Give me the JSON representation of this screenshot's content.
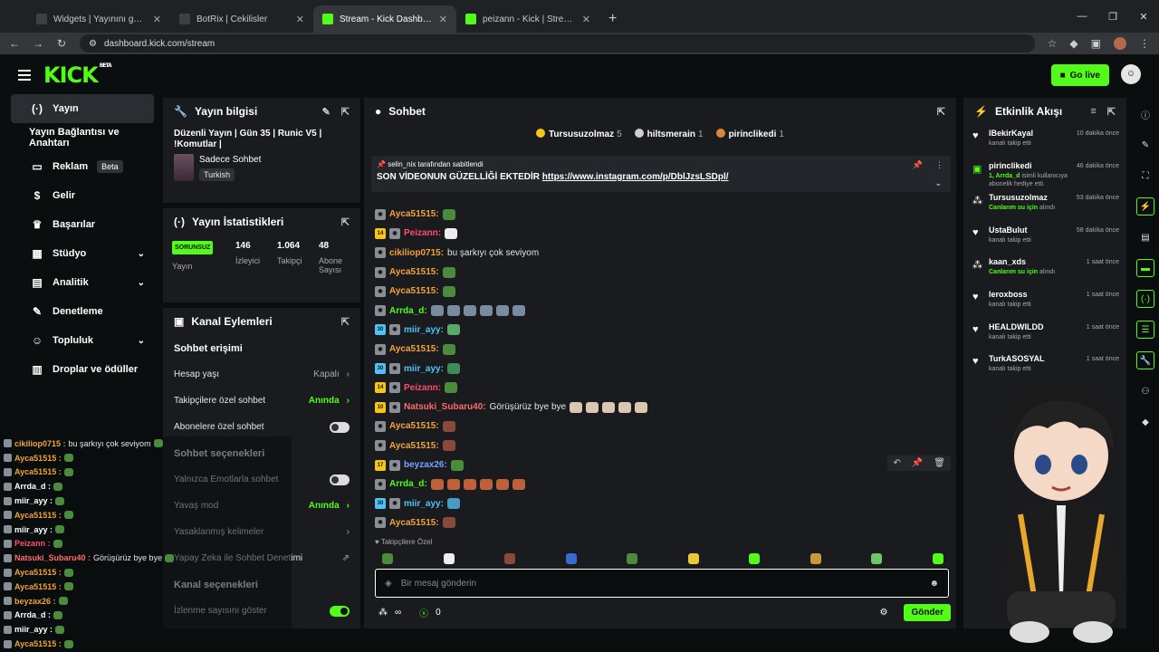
{
  "browser": {
    "tabs": [
      {
        "label": "Widgets | Yayınını güçlendirme",
        "color": "#3c4043",
        "active": false
      },
      {
        "label": "BotRix | Cekilisler",
        "color": "#3c4043",
        "active": false
      },
      {
        "label": "Stream - Kick Dashboard",
        "color": "#53fc18",
        "active": true
      },
      {
        "label": "peizann - Kick | StreamerStats",
        "color": "#53fc18",
        "active": false
      }
    ],
    "url": "dashboard.kick.com/stream"
  },
  "header": {
    "logo": "KICK",
    "beta": "BETA",
    "go_live": "Go live"
  },
  "sidebar": {
    "items": [
      {
        "icon": "(·)",
        "label": "Yayın",
        "active": true
      },
      {
        "icon": "",
        "label": "Yayın Bağlantısı ve Anahtarı",
        "sub": true
      },
      {
        "icon": "▭",
        "label": "Reklam",
        "badge": "Beta"
      },
      {
        "icon": "$",
        "label": "Gelir"
      },
      {
        "icon": "♛",
        "label": "Başarılar"
      },
      {
        "icon": "▦",
        "label": "Stüdyo",
        "chev": true
      },
      {
        "icon": "▤",
        "label": "Analitik",
        "chev": true
      },
      {
        "icon": "✎",
        "label": "Denetleme"
      },
      {
        "icon": "☺",
        "label": "Topluluk",
        "chev": true
      },
      {
        "icon": "▥",
        "label": "Droplar ve ödüller"
      }
    ]
  },
  "stream_info": {
    "title": "Yayın bilgisi",
    "stream_title": "Düzenli Yayın | Gün 35 | Runic V5 | !Komutlar |",
    "category": "Sadece Sohbet",
    "language": "Turkish"
  },
  "stream_stats": {
    "title": "Yayın İstatistikleri",
    "status": "SORUNSUZ",
    "status_label": "Yayın",
    "stats": [
      {
        "value": "146",
        "label": "İzleyici"
      },
      {
        "value": "1.064",
        "label": "Takipçi"
      },
      {
        "value": "48",
        "label": "Abone Sayısı"
      }
    ]
  },
  "channel_actions": {
    "title": "Kanal Eylemleri",
    "section1": "Sohbet erişimi",
    "rows1": [
      {
        "label": "Hesap yaşı",
        "value": "Kapalı",
        "kind": "chev"
      },
      {
        "label": "Takipçilere özel sohbet",
        "value": "Anında",
        "kind": "green"
      },
      {
        "label": "Abonelere özel sohbet",
        "value": "",
        "kind": "toggle"
      }
    ],
    "section2": "Sohbet seçenekleri",
    "rows2": [
      {
        "label": "Yalnızca Emotlarla sohbet",
        "value": "",
        "kind": "toggle"
      },
      {
        "label": "Yavaş mod",
        "value": "Anında",
        "kind": "green"
      },
      {
        "label": "Yasaklanmış kelimeler",
        "value": "",
        "kind": "chev"
      },
      {
        "label": "Yapay Zeka ile Sohbet Denetimi",
        "value": "",
        "kind": "ext"
      }
    ],
    "section3": "Kanal seçenekleri",
    "rows3": [
      {
        "label": "İzlenme sayısını göster",
        "value": "",
        "kind": "toggle-on"
      }
    ]
  },
  "chat": {
    "title": "Sohbet",
    "top_gifters": [
      {
        "name": "Tursusuzolmaz",
        "count": "5",
        "color": "#f5c518"
      },
      {
        "name": "hiltsmerain",
        "count": "1",
        "color": "#cfcfcf"
      },
      {
        "name": "pirinclikedi",
        "count": "1",
        "color": "#d9893b"
      }
    ],
    "pinned_by": "selin_nix tarafından sabitlendi",
    "pinned_text": "SON VİDEONUN GÜZELLİĞİ EKTEDİR",
    "pinned_link": "https://www.instagram.com/p/DblJzsLSDpl/",
    "messages": [
      {
        "user": "Ayca51515:",
        "color": "#f2a33a",
        "text": "",
        "sub": "",
        "emotes": [
          "#4a8c3c"
        ]
      },
      {
        "user": "Peizann:",
        "color": "#ff4d6a",
        "text": "",
        "sub": "14",
        "emotes": [
          "#eeeeee"
        ]
      },
      {
        "user": "cikiliop0715:",
        "color": "#f2a33a",
        "text": "bu şarkıyı çok seviyom",
        "sub": "",
        "emotes": []
      },
      {
        "user": "Ayca51515:",
        "color": "#f2a33a",
        "text": "",
        "sub": "",
        "emotes": [
          "#4a8c3c"
        ]
      },
      {
        "user": "Ayca51515:",
        "color": "#f2a33a",
        "text": "",
        "sub": "",
        "emotes": [
          "#4a8c3c"
        ]
      },
      {
        "user": "Arrda_d:",
        "color": "#53fc18",
        "text": "",
        "sub": "",
        "emotes": [
          "#7a8aa0",
          "#7a8aa0",
          "#7a8aa0",
          "#7a8aa0",
          "#7a8aa0",
          "#7a8aa0"
        ]
      },
      {
        "user": "miir_ayy:",
        "color": "#4fc3f7",
        "text": "",
        "sub": "30",
        "emotes": [
          "#5aa86a"
        ]
      },
      {
        "user": "Ayca51515:",
        "color": "#f2a33a",
        "text": "",
        "sub": "",
        "emotes": [
          "#4a8c3c"
        ]
      },
      {
        "user": "miir_ayy:",
        "color": "#4fc3f7",
        "text": "",
        "sub": "30",
        "emotes": [
          "#3c8c5a"
        ]
      },
      {
        "user": "Peizann:",
        "color": "#ff4d6a",
        "text": "",
        "sub": "14",
        "emotes": [
          "#4a8c3c"
        ]
      },
      {
        "user": "Natsuki_Subaru40:",
        "color": "#ff6b6b",
        "text": "Görüşürüz bye bye",
        "sub": "10",
        "emotes": [
          "#d8c8b0",
          "#d8c8b0",
          "#d8c8b0",
          "#d8c8b0",
          "#d8c8b0"
        ]
      },
      {
        "user": "Ayca51515:",
        "color": "#f2a33a",
        "text": "",
        "sub": "",
        "emotes": [
          "#8a4a3a"
        ]
      },
      {
        "user": "Ayca51515:",
        "color": "#f2a33a",
        "text": "",
        "sub": "",
        "emotes": [
          "#8a4a3a"
        ]
      },
      {
        "user": "beyzax26:",
        "color": "#7aa2ff",
        "text": "",
        "sub": "17",
        "emotes": [
          "#4a8c3c"
        ]
      },
      {
        "user": "Arrda_d:",
        "color": "#53fc18",
        "text": "",
        "sub": "",
        "emotes": [
          "#c0603a",
          "#c0603a",
          "#c0603a",
          "#c0603a",
          "#c0603a",
          "#c0603a"
        ]
      },
      {
        "user": "miir_ayy:",
        "color": "#4fc3f7",
        "text": "",
        "sub": "30",
        "emotes": [
          "#4a9ac8"
        ]
      },
      {
        "user": "Ayca51515:",
        "color": "#f2a33a",
        "text": "",
        "sub": "",
        "emotes": [
          "#8a4a3a"
        ]
      }
    ],
    "followers_label": "Takipçilere Özel",
    "placeholder": "Bir mesaj gönderin",
    "viewers": "∞",
    "count": "0",
    "send": "Gönder"
  },
  "activity": {
    "title": "Etkinlik Akışı",
    "events": [
      {
        "name": "IBekirKayal",
        "desc": "kanalı takip etti",
        "time": "10 dakika önce",
        "icon": "♥",
        "hl": ""
      },
      {
        "name": "pirinclikedi",
        "desc": " isimli kullanıcıya abonelik hediye etti.",
        "time": "46 dakika önce",
        "icon": "▣",
        "hl": "1, Arrda_d"
      },
      {
        "name": "Tursusuzolmaz",
        "desc": " alındı",
        "time": "53 dakika önce",
        "icon": "⁂",
        "hl": "Canlarım su için"
      },
      {
        "name": "UstaBulut",
        "desc": "kanalı takip etti",
        "time": "58 dakika önce",
        "icon": "♥",
        "hl": ""
      },
      {
        "name": "kaan_xds",
        "desc": " alındı",
        "time": "1 saat önce",
        "icon": "⁂",
        "hl": "Canlarım su için"
      },
      {
        "name": "leroxboss",
        "desc": "kanalı takip etti",
        "time": "1 saat önce",
        "icon": "♥",
        "hl": ""
      },
      {
        "name": "HEALDWILDD",
        "desc": "kanalı takip etti",
        "time": "1 saat önce",
        "icon": "♥",
        "hl": ""
      },
      {
        "name": "TurkASOSYAL",
        "desc": "kanalı takip etti",
        "time": "1 saat önce",
        "icon": "♥",
        "hl": ""
      }
    ]
  },
  "overlay_chat": [
    {
      "user": "cikiliop0715 :",
      "color": "#f2a33a",
      "text": "bu şarkıyı çok seviyom"
    },
    {
      "user": "Ayca51515 :",
      "color": "#f2a33a",
      "text": ""
    },
    {
      "user": "Ayca51515 :",
      "color": "#f2a33a",
      "text": ""
    },
    {
      "user": "Arrda_d :",
      "color": "#ffffff",
      "text": ""
    },
    {
      "user": "miir_ayy :",
      "color": "#ffffff",
      "text": ""
    },
    {
      "user": "Ayca51515 :",
      "color": "#f2a33a",
      "text": ""
    },
    {
      "user": "miir_ayy :",
      "color": "#ffffff",
      "text": ""
    },
    {
      "user": "Peizann :",
      "color": "#ff4d6a",
      "text": ""
    },
    {
      "user": "Natsuki_Subaru40 :",
      "color": "#ff6b6b",
      "text": "Görüşürüz bye bye"
    },
    {
      "user": "Ayca51515 :",
      "color": "#f2a33a",
      "text": ""
    },
    {
      "user": "Ayca51515 :",
      "color": "#f2a33a",
      "text": ""
    },
    {
      "user": "beyzax26 :",
      "color": "#f2a33a",
      "text": ""
    },
    {
      "user": "Arrda_d :",
      "color": "#ffffff",
      "text": ""
    },
    {
      "user": "miir_ayy :",
      "color": "#ffffff",
      "text": ""
    },
    {
      "user": "Ayca51515 :",
      "color": "#f2a33a",
      "text": ""
    }
  ]
}
